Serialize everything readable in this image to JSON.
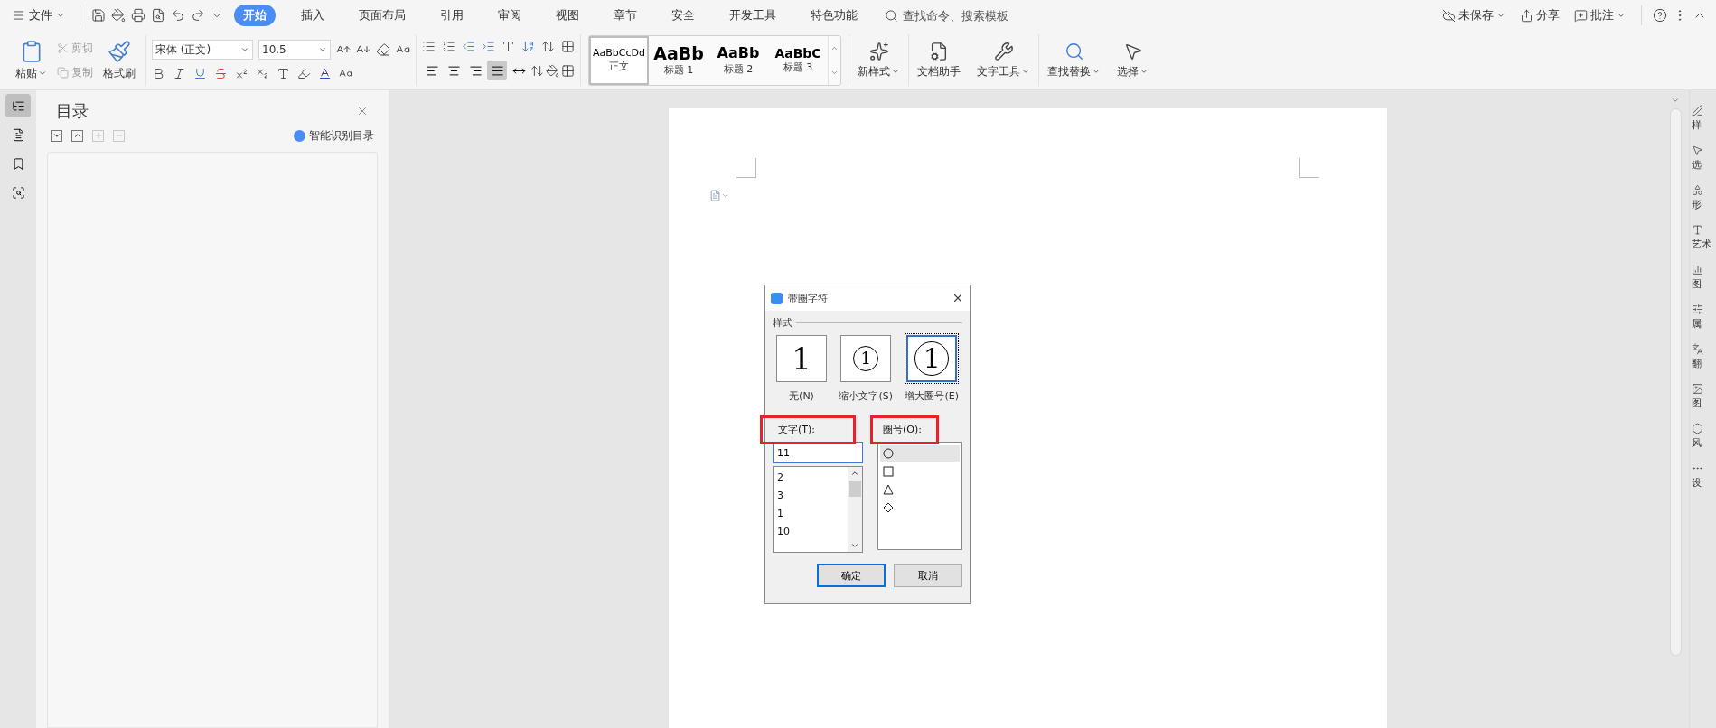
{
  "title_bar": {
    "file_menu": "文件",
    "tabs": [
      {
        "label": "开始",
        "selected": true
      },
      {
        "label": "插入",
        "selected": false
      },
      {
        "label": "页面布局",
        "selected": false
      },
      {
        "label": "引用",
        "selected": false
      },
      {
        "label": "审阅",
        "selected": false
      },
      {
        "label": "视图",
        "selected": false
      },
      {
        "label": "章节",
        "selected": false
      },
      {
        "label": "安全",
        "selected": false
      },
      {
        "label": "开发工具",
        "selected": false
      },
      {
        "label": "特色功能",
        "selected": false
      }
    ],
    "search": {
      "placeholder": "查找命令、搜索模板"
    },
    "actions": [
      {
        "kind": "save-status",
        "label": "未保存",
        "dropdown": true
      },
      {
        "kind": "share",
        "label": "分享",
        "dropdown": false
      },
      {
        "kind": "comment",
        "label": "批注",
        "dropdown": true
      }
    ]
  },
  "ribbon": {
    "clipboard": {
      "paste": "粘贴",
      "cut": {
        "label": "剪切",
        "disabled": true
      },
      "copy": {
        "label": "复制",
        "disabled": true
      },
      "format_painter": "格式刷"
    },
    "font": {
      "name": "宋体 (正文)",
      "size": "10.5"
    },
    "alignments": [
      {
        "kind": "left",
        "selected": false
      },
      {
        "kind": "center",
        "selected": false
      },
      {
        "kind": "right",
        "selected": false
      },
      {
        "kind": "justify",
        "selected": true
      },
      {
        "kind": "distributed",
        "selected": false
      }
    ],
    "styles": [
      {
        "preview": "AaBbCcDd",
        "label": "正文",
        "selected": true
      },
      {
        "preview": "AaBb",
        "label": "标题 1",
        "selected": false
      },
      {
        "preview": "AaBb",
        "label": "标题 2",
        "selected": false
      },
      {
        "preview": "AaBbC",
        "label": "标题 3",
        "selected": false
      }
    ],
    "tools": [
      {
        "kind": "new-style",
        "label": "新样式",
        "dropdown": true
      },
      {
        "kind": "doc-assistant",
        "label": "文档助手",
        "dropdown": false
      },
      {
        "kind": "text-tools",
        "label": "文字工具",
        "dropdown": true
      },
      {
        "kind": "find-replace",
        "label": "查找替换",
        "dropdown": true
      },
      {
        "kind": "select",
        "label": "选择",
        "dropdown": true
      }
    ]
  },
  "left_nav": [
    {
      "kind": "toc",
      "selected": true
    },
    {
      "kind": "document",
      "selected": false
    },
    {
      "kind": "bookmark",
      "selected": false
    },
    {
      "kind": "find",
      "selected": false
    }
  ],
  "toc_panel": {
    "title": "目录",
    "smart_link": "智能识别目录"
  },
  "dialog": {
    "title": "带圈字符",
    "style_group": "样式",
    "styles": [
      {
        "kind": "none",
        "preview": "1",
        "label": "无(N)",
        "selected": false
      },
      {
        "kind": "shrink",
        "preview": "1",
        "label": "缩小文字(S)",
        "selected": false
      },
      {
        "kind": "enlarge",
        "preview": "1",
        "label": "增大圈号(E)",
        "selected": true
      }
    ],
    "text": {
      "label": "文字(T):",
      "highlighted": true,
      "value": "11",
      "options": [
        "2",
        "3",
        "1",
        "10"
      ]
    },
    "enclosure": {
      "label": "圈号(O):",
      "highlighted": true,
      "options": [
        {
          "kind": "circle",
          "selected": true
        },
        {
          "kind": "square",
          "selected": false
        },
        {
          "kind": "triangle",
          "selected": false
        },
        {
          "kind": "diamond",
          "selected": false
        }
      ]
    },
    "buttons": [
      {
        "label": "确定",
        "default": true
      },
      {
        "label": "取消",
        "default": false
      }
    ]
  },
  "right_sidebar": [
    {
      "kind": "style",
      "label": "样"
    },
    {
      "kind": "select",
      "label": "选"
    },
    {
      "kind": "shape",
      "label": "形"
    },
    {
      "kind": "art",
      "label": "艺术"
    },
    {
      "kind": "chart",
      "label": "图"
    },
    {
      "kind": "property",
      "label": "属"
    },
    {
      "kind": "translate",
      "label": "翻"
    },
    {
      "kind": "image",
      "label": "图"
    },
    {
      "kind": "theme",
      "label": "风"
    },
    {
      "kind": "settings",
      "label": "设"
    }
  ]
}
